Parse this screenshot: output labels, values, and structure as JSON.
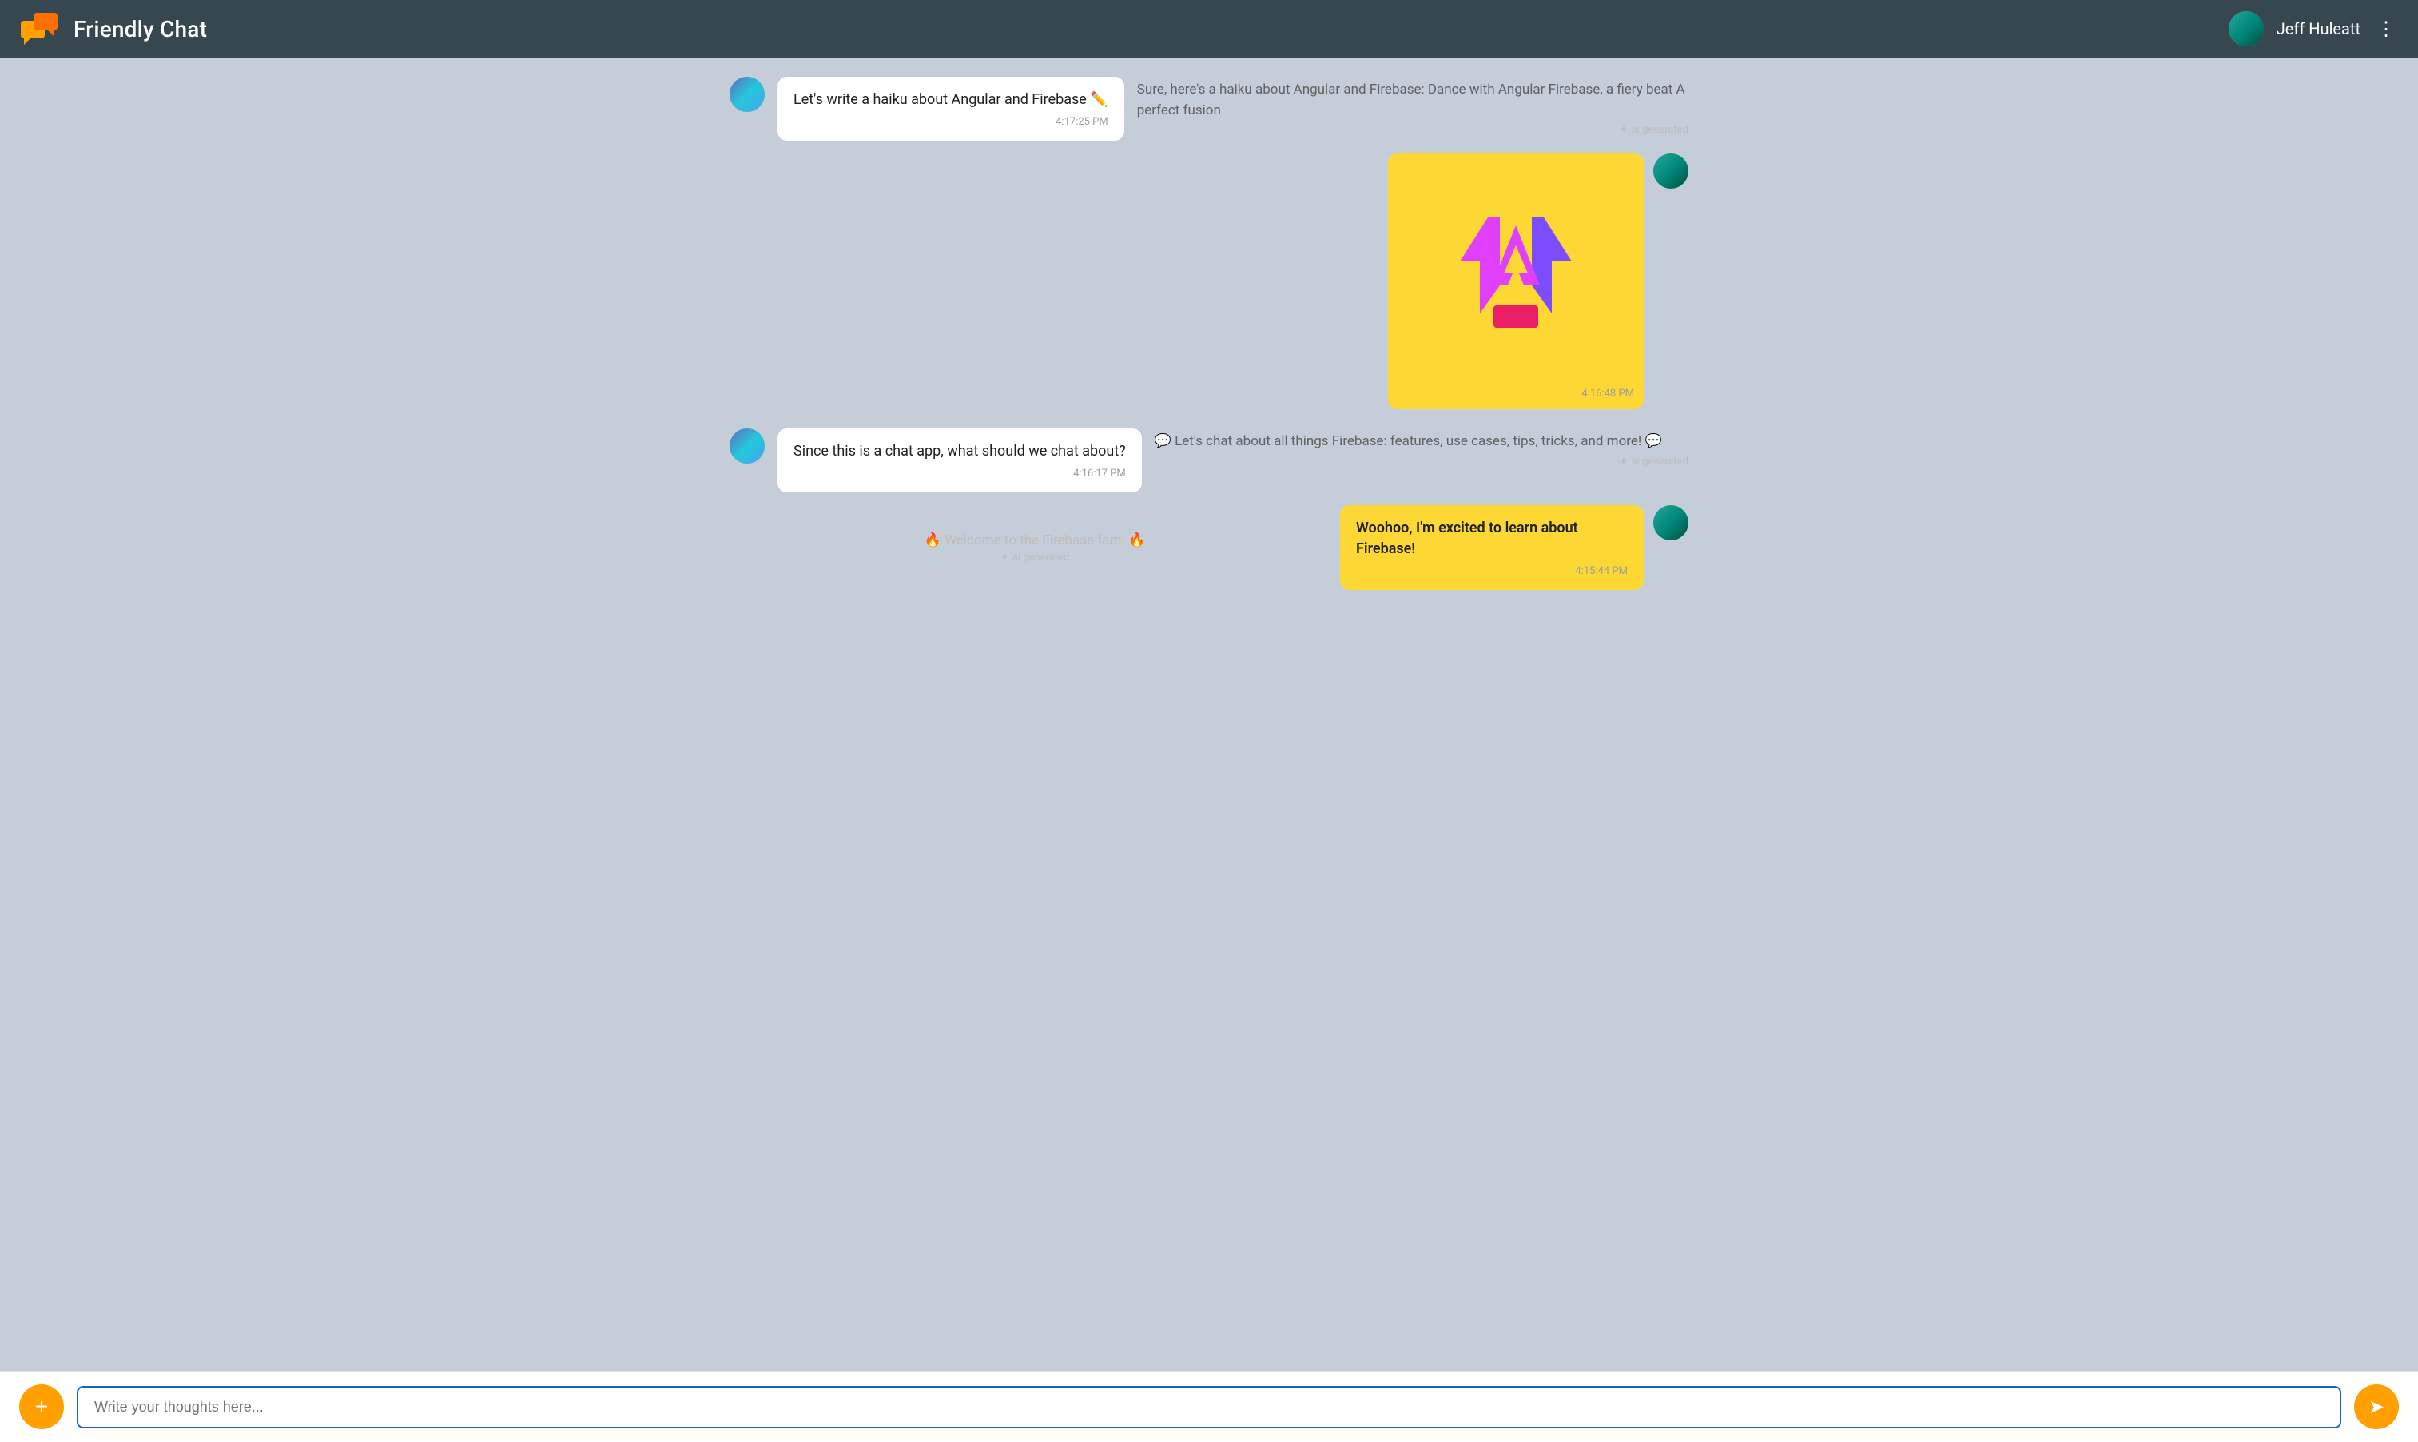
{
  "header": {
    "title": "Friendly Chat",
    "username": "Jeff Huleatt",
    "menu_icon": "⋮"
  },
  "messages": [
    {
      "id": "msg1",
      "type": "user_with_ai",
      "avatar_side": "left",
      "bubble_text": "Let's write a haiku about Angular and Firebase ✏️",
      "bubble_time": "4:17:25 PM",
      "ai_text": "Sure, here's a haiku about Angular and Firebase: Dance with Angular Firebase, a fiery beat A perfect fusion",
      "ai_badge": "ai generated"
    },
    {
      "id": "msg2",
      "type": "image_right",
      "image_time": "4:16:48 PM"
    },
    {
      "id": "msg3",
      "type": "user_with_ai",
      "avatar_side": "left",
      "bubble_text": "Since this is a chat app, what should we chat about?",
      "bubble_time": "4:16:17 PM",
      "ai_text": "💬 Let's chat about all things Firebase: features, use cases, tips, tricks, and more! 💬",
      "ai_badge": "ai generated"
    },
    {
      "id": "msg4",
      "type": "center_ai",
      "ai_text": "🔥 Welcome to the Firebase fam! 🔥",
      "ai_badge": "ai generated"
    },
    {
      "id": "msg5",
      "type": "user_bubble_right",
      "bubble_text": "Woohoo, I'm excited to learn about Firebase!",
      "bubble_time": "4:15:44 PM"
    }
  ],
  "footer": {
    "add_label": "+",
    "input_placeholder": "Write your thoughts here...",
    "send_icon": "➣"
  }
}
